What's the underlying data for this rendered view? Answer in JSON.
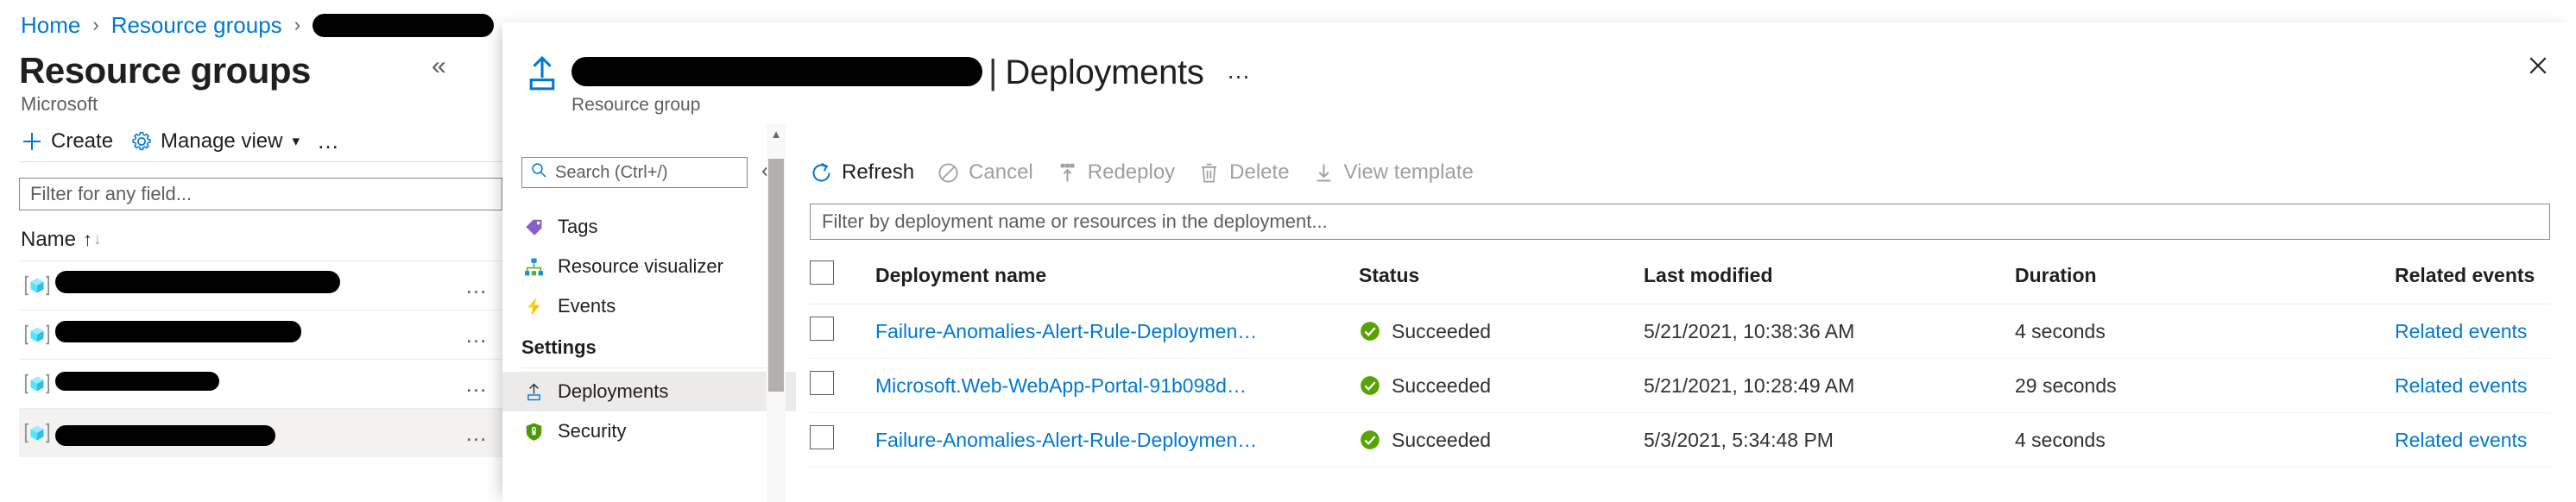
{
  "background_blade": {
    "breadcrumb": {
      "home": "Home",
      "resource_groups": "Resource groups",
      "current_redacted": ""
    },
    "title": "Resource groups",
    "subtitle": "Microsoft",
    "collapse_icon": "chevron-double-left-icon",
    "commands": [
      {
        "label": "Create",
        "icon": "plus-icon"
      },
      {
        "label": "Manage view",
        "icon": "gear-icon",
        "has_chevron": true
      }
    ],
    "more_commands_label": "…",
    "filter_placeholder": "Filter for any field...",
    "column_header_name": "Name",
    "sort_up": "↑",
    "sort_down": "↓",
    "rows": [
      {
        "icon": "resource-group-cube-icon",
        "name_redacted": true,
        "selected": false
      },
      {
        "icon": "resource-group-cube-icon",
        "name_redacted": true,
        "selected": false
      },
      {
        "icon": "resource-group-cube-icon",
        "name_redacted": true,
        "selected": false
      },
      {
        "icon": "resource-group-cube-icon",
        "name_redacted": true,
        "selected": true
      }
    ],
    "row_menu_label": "…"
  },
  "panel": {
    "icon": "resource-group-deployment-icon",
    "resource_name_redacted": "",
    "title_separator": "|",
    "title": "Deployments",
    "more_label": "…",
    "subtitle": "Resource group",
    "close_label": "✕",
    "nav": {
      "search_placeholder": "Search (Ctrl+/)",
      "search_icon": "search-icon",
      "collapse_icon": "chevron-double-left-icon",
      "items": [
        {
          "label": "Tags",
          "icon": "tag-icon",
          "active": false
        },
        {
          "label": "Resource visualizer",
          "icon": "resource-visualizer-icon",
          "active": false
        },
        {
          "label": "Events",
          "icon": "lightning-bolt-icon",
          "active": false
        }
      ],
      "group_label": "Settings",
      "settings_items": [
        {
          "label": "Deployments",
          "icon": "deployment-upload-icon",
          "active": true
        },
        {
          "label": "Security",
          "icon": "shield-icon",
          "active": false
        }
      ]
    },
    "commands": [
      {
        "label": "Refresh",
        "icon": "refresh-icon",
        "disabled": false
      },
      {
        "label": "Cancel",
        "icon": "cancel-icon",
        "disabled": true
      },
      {
        "label": "Redeploy",
        "icon": "redeploy-icon",
        "disabled": true
      },
      {
        "label": "Delete",
        "icon": "trash-icon",
        "disabled": true
      },
      {
        "label": "View template",
        "icon": "download-icon",
        "disabled": true
      }
    ],
    "filter_placeholder": "Filter by deployment name or resources in the deployment...",
    "table": {
      "columns": [
        "Deployment name",
        "Status",
        "Last modified",
        "Duration",
        "Related events"
      ],
      "rows": [
        {
          "name": "Failure-Anomalies-Alert-Rule-Deploymen…",
          "status": "Succeeded",
          "status_icon": "success-check-icon",
          "last_modified": "5/21/2021, 10:38:36 AM",
          "duration": "4 seconds",
          "related_events": "Related events"
        },
        {
          "name": "Microsoft.Web-WebApp-Portal-91b098d…",
          "status": "Succeeded",
          "status_icon": "success-check-icon",
          "last_modified": "5/21/2021, 10:28:49 AM",
          "duration": "29 seconds",
          "related_events": "Related events"
        },
        {
          "name": "Failure-Anomalies-Alert-Rule-Deploymen…",
          "status": "Succeeded",
          "status_icon": "success-check-icon",
          "last_modified": "5/3/2021, 5:34:48 PM",
          "duration": "4 seconds",
          "related_events": "Related events"
        }
      ]
    }
  },
  "colors": {
    "link": "#0078d4",
    "success_green": "#57a300",
    "text": "#201f1e",
    "muted": "#605e5c",
    "disabled": "#a19f9d",
    "selected_bg": "#f3f2f1",
    "tag_purple": "#8661c5",
    "bolt_yellow": "#ffb900",
    "shield_green": "#4e9a06"
  }
}
